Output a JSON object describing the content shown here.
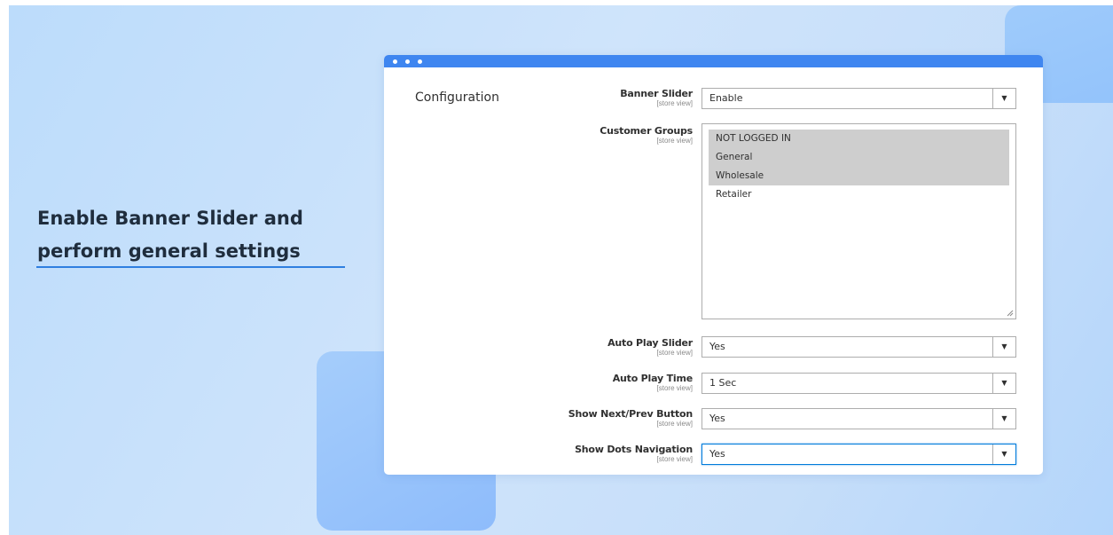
{
  "headline": {
    "line1": "Enable Banner Slider and",
    "line2": "perform general settings"
  },
  "window": {
    "section_title": "Configuration",
    "fields": {
      "banner_slider": {
        "label": "Banner Slider",
        "scope": "[store view]",
        "value": "Enable"
      },
      "customer_groups": {
        "label": "Customer Groups",
        "scope": "[store view]",
        "options": [
          {
            "label": "NOT LOGGED IN",
            "selected": true
          },
          {
            "label": "General",
            "selected": true
          },
          {
            "label": "Wholesale",
            "selected": true
          },
          {
            "label": "Retailer",
            "selected": false
          }
        ]
      },
      "auto_play_slider": {
        "label": "Auto Play Slider",
        "scope": "[store view]",
        "value": "Yes"
      },
      "auto_play_time": {
        "label": "Auto Play Time",
        "scope": "[store view]",
        "value": "1 Sec"
      },
      "show_next_prev": {
        "label": "Show Next/Prev Button",
        "scope": "[store view]",
        "value": "Yes"
      },
      "show_dots": {
        "label": "Show Dots Navigation",
        "scope": "[store view]",
        "value": "Yes"
      }
    }
  },
  "icons": {
    "dropdown": "chevron-down-icon",
    "resize": "resize-handle-icon"
  },
  "colors": {
    "window_bar": "#3f86f0",
    "accent_underline": "#2f7fe0",
    "selected_option": "#cecece",
    "focus_border": "#007bdb"
  }
}
